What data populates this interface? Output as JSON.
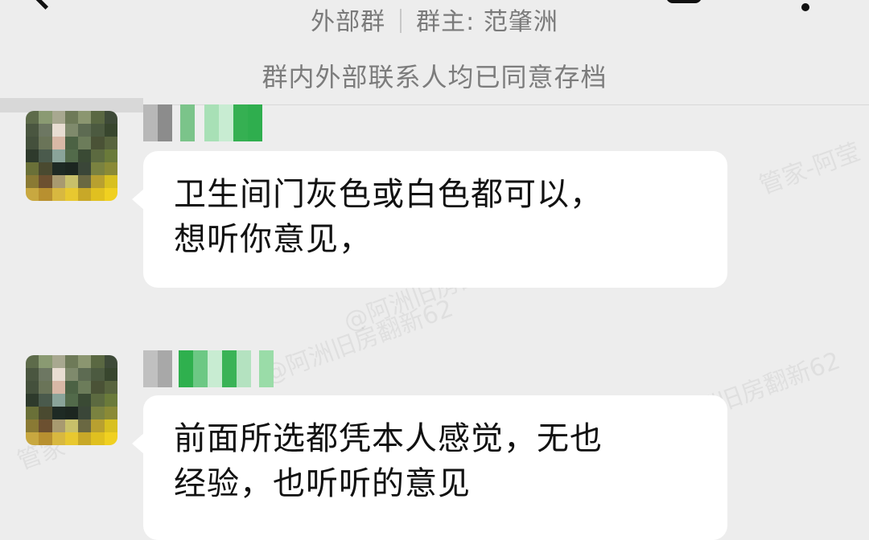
{
  "header": {
    "group_name": "外部群",
    "owner_label": "群主: 范肇洲"
  },
  "notice": "群内外部联系人均已同意存档",
  "messages": [
    {
      "text_lines": [
        "卫生间门灰色或白色都可以，",
        "想听你意见，"
      ]
    },
    {
      "text_lines": [
        "前面所选都凭本人感觉，无也",
        "经验，也听听的意见"
      ]
    }
  ],
  "watermarks": [
    "管家-阿莹",
    "@阿洲旧房翻新62",
    "阿洲旧房翻新62",
    "管家",
    "@阿洲旧房翻新62"
  ],
  "colors": {
    "background": "#ededed",
    "bubble": "#ffffff",
    "text": "#111111",
    "meta": "#7a7a7a"
  },
  "icons": [
    "back-icon",
    "menu-icon",
    "more-icon"
  ]
}
